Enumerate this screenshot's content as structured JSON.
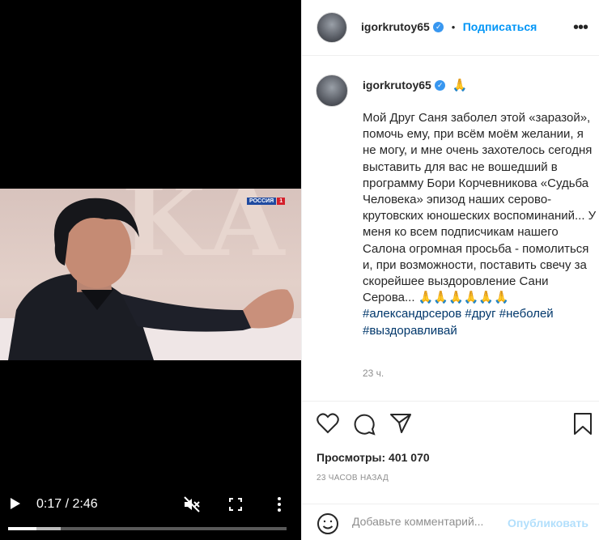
{
  "video": {
    "channel_logo_left": "РОССИЯ",
    "channel_logo_right": "1",
    "time_display": "0:17 / 2:46",
    "progress_fraction": 0.103,
    "buffered_fraction": 0.19,
    "icons": {
      "play": "play-icon",
      "mute": "volume-muted-icon",
      "fullscreen": "fullscreen-icon",
      "more": "more-vertical-icon"
    }
  },
  "header": {
    "username": "igorkrutoy65",
    "separator": "•",
    "follow_label": "Подписаться",
    "more": "•••"
  },
  "post": {
    "username": "igorkrutoy65",
    "title_emoji": "🙏",
    "caption": "Мой Друг Саня заболел этой «заразой», помочь ему, при всём моём желании, я не могу, и мне очень захотелось сегодня выставить для вас не вошедший в программу Бори Корчевникова «Судьба Человека» эпизод наших серово-крутовских юношеских воспоминаний... У меня ко всем подписчикам нашего Салона огромная просьба - помолиться и, при возможности, поставить свечу за скорейшее выздоровление Сани Серова... 🙏🙏🙏🙏🙏🙏",
    "hashtags": "#александрсеров #друг #неболей #выздоравливай",
    "time_ago": "23 ч."
  },
  "actions": {
    "icons": [
      "heart-icon",
      "comment-icon",
      "share-icon",
      "bookmark-icon"
    ]
  },
  "stats": {
    "views_label": "Просмотры: 401 070",
    "posted": "23 часов назад"
  },
  "comment_box": {
    "placeholder": "Добавьте комментарий...",
    "publish_label": "Опубликовать"
  },
  "colors": {
    "accent": "#0095f6",
    "link": "#00376b",
    "muted": "#8e8e8e"
  }
}
